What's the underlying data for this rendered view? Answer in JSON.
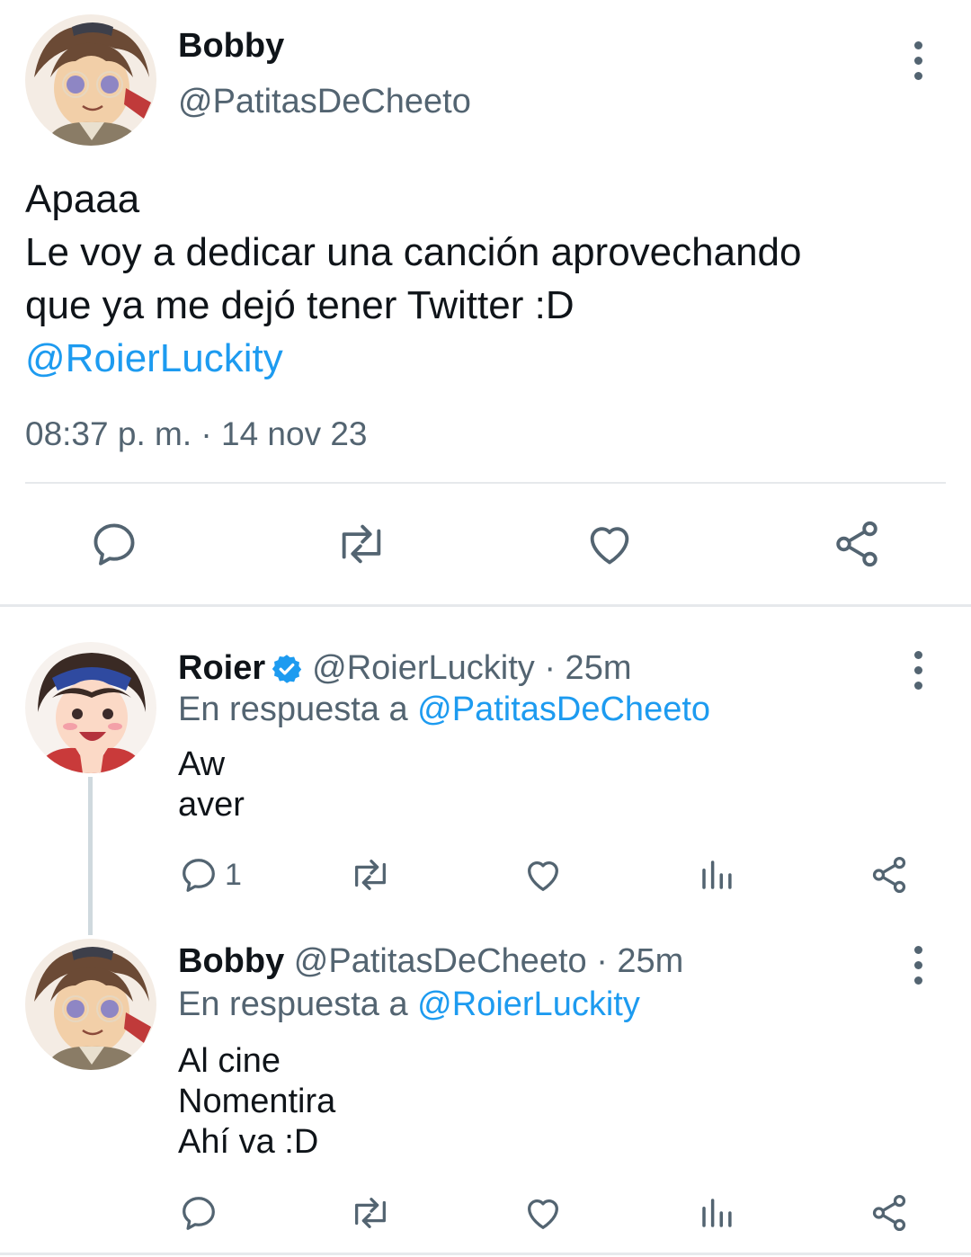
{
  "main_tweet": {
    "author_name": "Bobby",
    "handle": "@PatitasDeCheeto",
    "text_lines": [
      "Apaaa",
      "Le voy a dedicar una canción aprovechando",
      "que ya me dejó tener Twitter :D"
    ],
    "mention": "@RoierLuckity",
    "timestamp": "08:37 p. m. · 14 nov 23"
  },
  "replies": [
    {
      "author_name": "Roier",
      "verified": true,
      "handle_time": "@RoierLuckity · 25m",
      "reply_prefix": "En respuesta a",
      "reply_to": "@PatitasDeCheeto",
      "text_lines": [
        "Aw",
        "aver"
      ],
      "reply_count": "1"
    },
    {
      "author_name": "Bobby",
      "verified": false,
      "handle_time": "@PatitasDeCheeto · 25m",
      "reply_prefix": "En respuesta a",
      "reply_to": "@RoierLuckity",
      "text_lines": [
        "Al cine",
        "Nomentira",
        "Ahí va :D"
      ],
      "reply_count": ""
    }
  ],
  "colors": {
    "accent": "#1d9bf0",
    "muted": "#536471",
    "text": "#0f1419",
    "verified": "#1d9bf0"
  },
  "icons": [
    "reply-icon",
    "retweet-icon",
    "like-icon",
    "share-icon",
    "views-icon",
    "more-icon",
    "verified-icon"
  ]
}
